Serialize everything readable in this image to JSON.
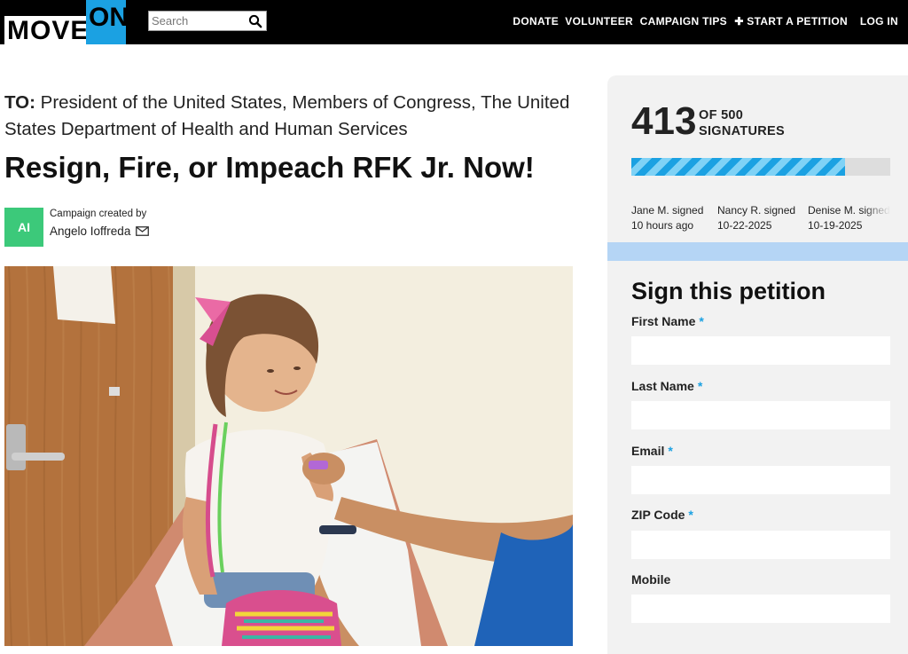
{
  "header": {
    "logo_move": "MOVE",
    "logo_on": "ON",
    "search_placeholder": "Search",
    "nav": [
      "DONATE",
      "VOLUNTEER",
      "CAMPAIGN TIPS",
      "✚ START A PETITION",
      "LOG IN"
    ]
  },
  "petition": {
    "to_prefix": "TO:",
    "to_text": "President of the United States, Members of Congress, The United States Department of Health and Human Services",
    "title": "Resign, Fire, or Impeach RFK Jr. Now!",
    "creator_initials": "AI",
    "creator_caption": "Campaign created by",
    "creator_name": "Angelo Ioffreda"
  },
  "signatures": {
    "count": "413",
    "goal_line1": "OF 500",
    "goal_line2": "SIGNATURES",
    "progress_fraction": 0.826,
    "recent": [
      {
        "name": "Jane M. signed",
        "when": "10 hours ago"
      },
      {
        "name": "Nancy R. signed",
        "when": "10-22-2025"
      },
      {
        "name": "Denise M. signed",
        "when": "10-19-2025"
      }
    ]
  },
  "form": {
    "title": "Sign this petition",
    "fields": [
      {
        "label": "First Name",
        "required": "*"
      },
      {
        "label": "Last Name",
        "required": "*"
      },
      {
        "label": "Email",
        "required": "*"
      },
      {
        "label": "ZIP Code",
        "required": "*"
      },
      {
        "label": "Mobile",
        "required": ""
      }
    ]
  },
  "colors": {
    "brand_blue": "#1ba1e2",
    "header_bg": "#000000",
    "avatar_green": "#3cc97a",
    "panel_bg": "#f2f2f2",
    "strip_blue": "#b5d5f5"
  }
}
